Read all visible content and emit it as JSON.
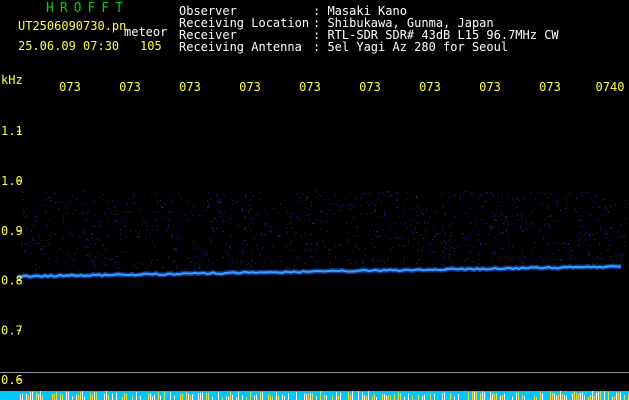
{
  "header": {
    "station": "HROFFT",
    "filename": "UT2506090730.pn",
    "meteor_label": "meteor",
    "datetime": "25.06.09 07:30",
    "count": "105",
    "meta": [
      {
        "label": "Observer",
        "value": ": Masaki Kano"
      },
      {
        "label": "Receiving Location",
        "value": ": Shibukawa, Gunma, Japan"
      },
      {
        "label": "Receiver",
        "value": ": RTL-SDR SDR# 43dB L15 96.7MHz CW"
      },
      {
        "label": "Receiving Antenna",
        "value": ": 5el Yagi Az 280 for Seoul"
      }
    ]
  },
  "chart_data": {
    "type": "heatmap",
    "ylabel": "kHz",
    "x_tick_labels": [
      "073",
      "073",
      "073",
      "073",
      "073",
      "073",
      "073",
      "073",
      "073",
      "0740"
    ],
    "y_ticks": [
      {
        "value": 1.1,
        "label": "1.1"
      },
      {
        "value": 1.0,
        "label": "1.0"
      },
      {
        "value": 0.9,
        "label": "0.9"
      },
      {
        "value": 0.8,
        "label": "0.8"
      },
      {
        "value": 0.7,
        "label": "0.7"
      },
      {
        "value": 0.6,
        "label": "0.6"
      }
    ],
    "ylim": [
      0.58,
      1.2
    ],
    "carrier_trace": {
      "start_khz": 0.808,
      "end_khz": 0.828
    },
    "noise_band_khz": [
      0.82,
      0.98
    ],
    "reference_line_khz": 0.615,
    "colors": {
      "background": "#000000",
      "carrier": "#3aa0ff",
      "noise": "#1a2aa0",
      "axis_text": "#ffff40",
      "bottom_band": "#00c8ff"
    }
  }
}
